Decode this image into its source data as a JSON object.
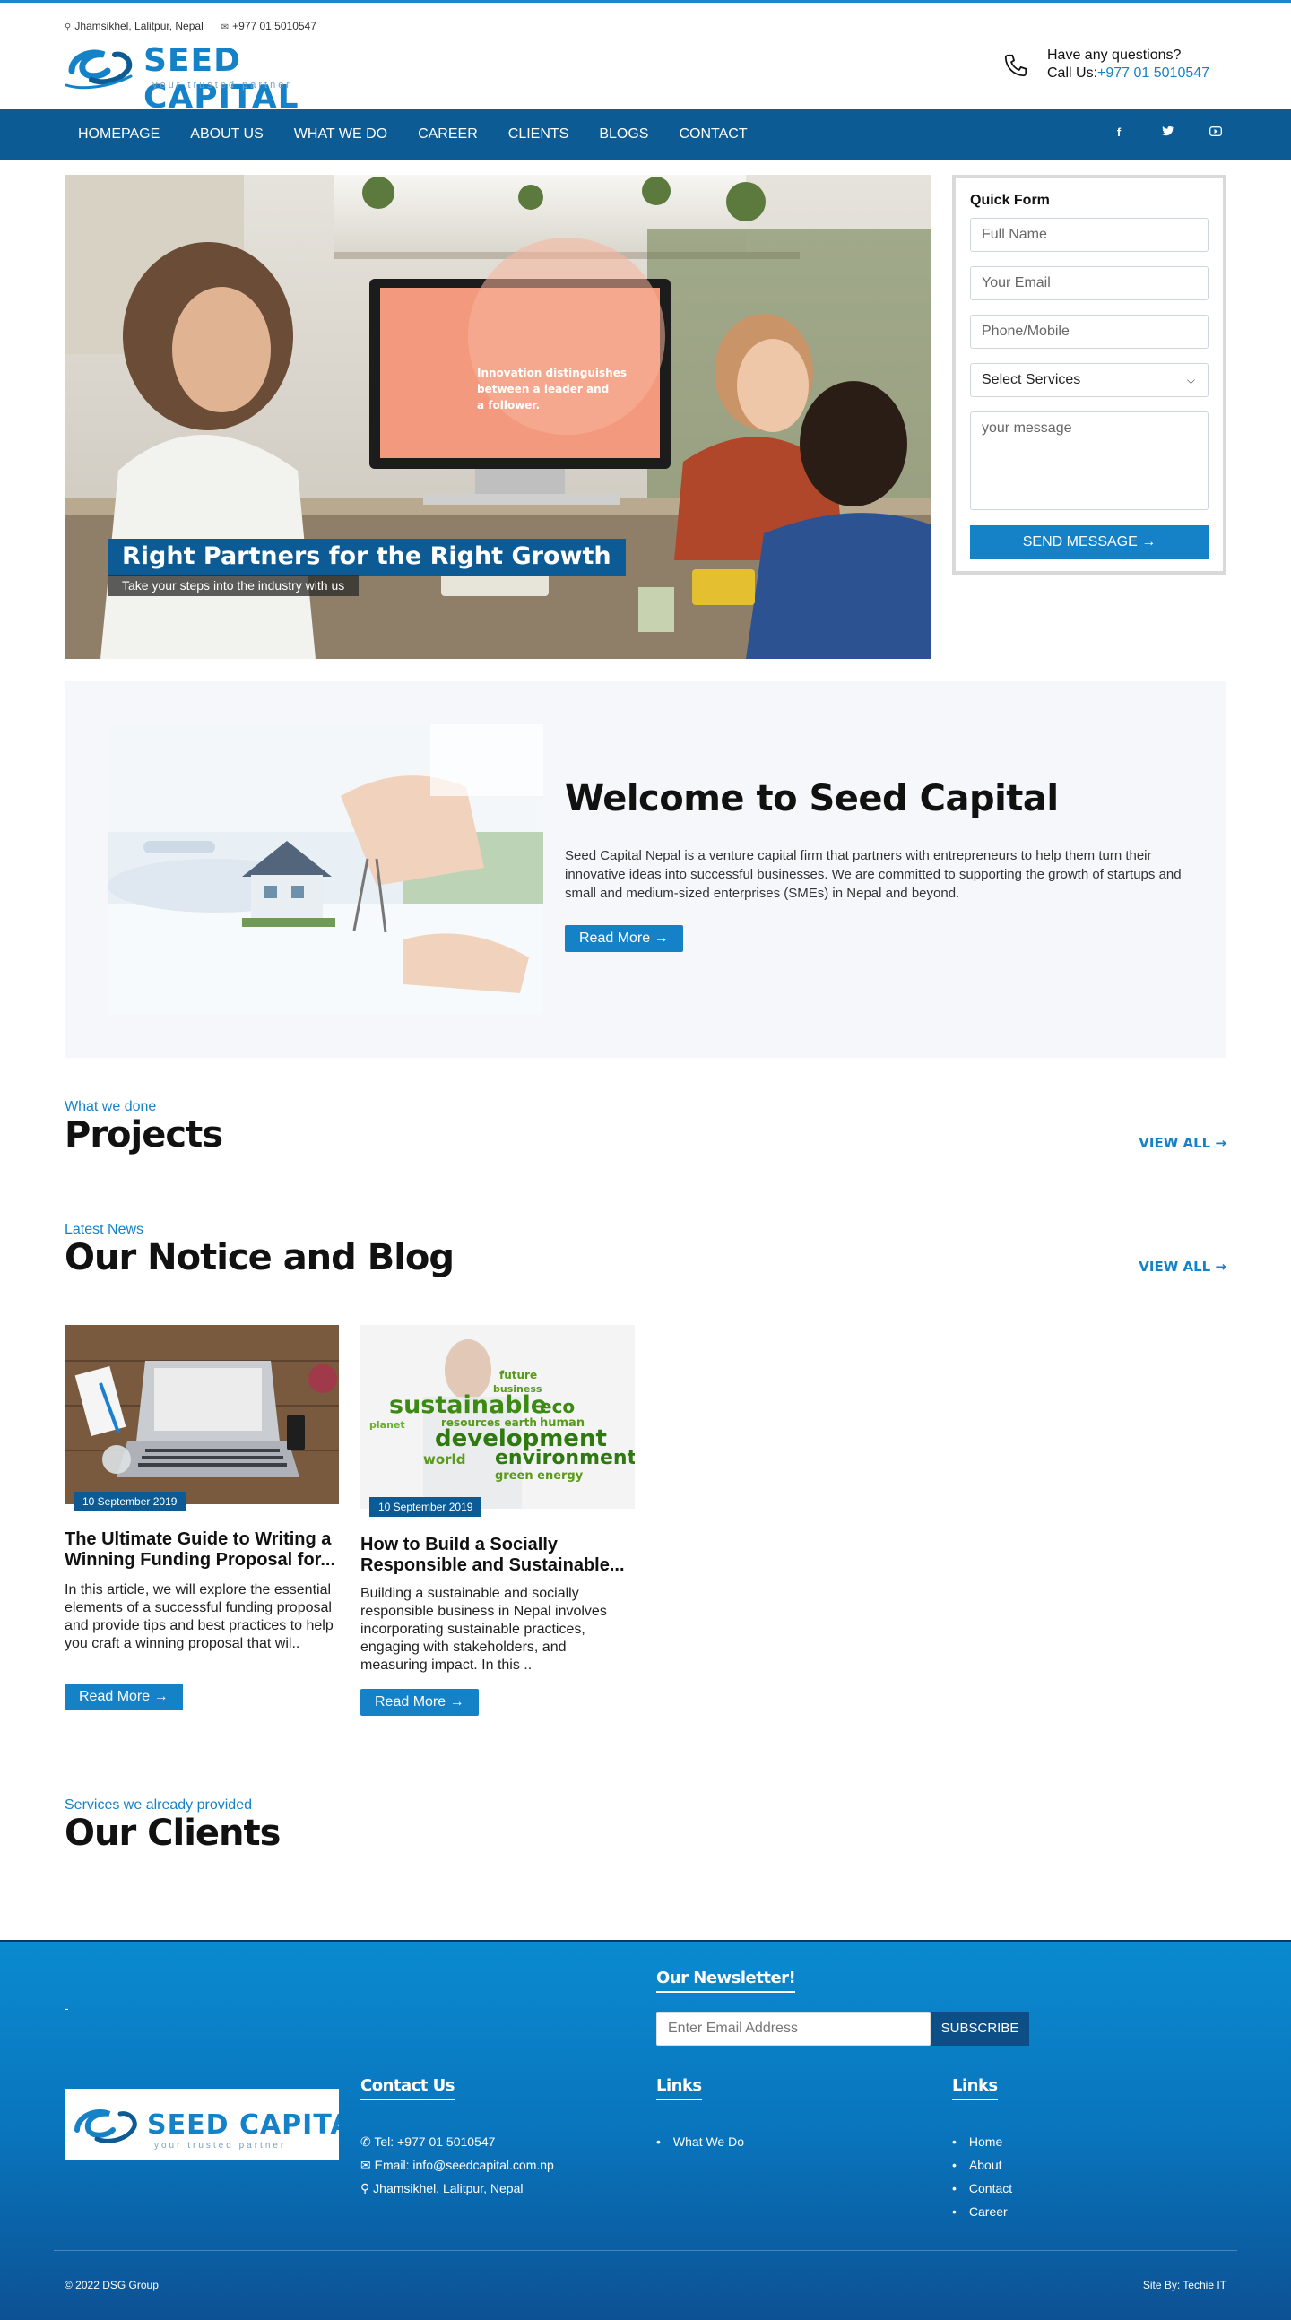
{
  "topbar": {
    "address": "Jhamsikhel, Lalitpur, Nepal",
    "phone": "+977 01 5010547"
  },
  "logo": {
    "name": "SEED CAPITAL",
    "tagline": "your trusted partner"
  },
  "contact_box": {
    "question": "Have any questions?",
    "call_label": "Call Us:",
    "call_number": "+977 01 5010547"
  },
  "nav": {
    "items": [
      "HOMEPAGE",
      "ABOUT US",
      "WHAT WE DO",
      "CAREER",
      "CLIENTS",
      "BLOGS",
      "CONTACT"
    ],
    "social": [
      "facebook-icon",
      "twitter-icon",
      "youtube-icon"
    ]
  },
  "hero": {
    "title": "Right Partners for the Right Growth",
    "subtitle": "Take your steps into the industry with us",
    "screen_text": "Innovation distinguishes between a leader and a follower."
  },
  "quick_form": {
    "title": "Quick Form",
    "full_name_placeholder": "Full Name",
    "email_placeholder": "Your Email",
    "phone_placeholder": "Phone/Mobile",
    "services_selected": "Select Services",
    "message_placeholder": "your message",
    "submit_label": "SEND MESSAGE →"
  },
  "welcome": {
    "title": "Welcome to Seed Capital",
    "text": "Seed Capital Nepal is a venture capital firm that partners with entrepreneurs to help them turn their innovative ideas into successful businesses. We are committed to supporting the growth of startups and small and medium-sized enterprises (SMEs) in Nepal and beyond.",
    "button": "Read More →"
  },
  "projects": {
    "eyebrow": "What we done",
    "title": "Projects",
    "view_all": "VIEW ALL →"
  },
  "blog": {
    "eyebrow": "Latest News",
    "title": "Our Notice and Blog",
    "view_all": "VIEW ALL →",
    "posts": [
      {
        "date": "10 September 2019",
        "title": "The Ultimate Guide to Writing a Winning Funding Proposal for...",
        "excerpt": "In this article, we will explore the essential elements of a successful funding proposal and provide tips and best practices to help you craft a winning proposal that wil..",
        "button": "Read More →"
      },
      {
        "date": "10 September 2019",
        "title": "How to Build a Socially Responsible and Sustainable...",
        "excerpt": "Building a sustainable and socially responsible business in Nepal involves incorporating sustainable practices, engaging with stakeholders, and measuring impact. In this ..",
        "button": "Read More →"
      }
    ]
  },
  "clients": {
    "eyebrow": "Services we already provided",
    "title": "Our Clients"
  },
  "footer": {
    "dash": "-",
    "newsletter_title": "Our Newsletter!",
    "newsletter_placeholder": "Enter Email Address",
    "subscribe": "SUBSCRIBE",
    "contact_title": "Contact Us",
    "contact_items": [
      "Tel: +977 01 5010547",
      "Email: info@seedcapital.com.np",
      "Jhamsikhel, Lalitpur, Nepal"
    ],
    "links1_title": "Links",
    "links1": [
      "What We Do"
    ],
    "links2_title": "Links",
    "links2": [
      "Home",
      "About",
      "Contact",
      "Career"
    ],
    "copyright": "© 2022 DSG Group",
    "site_by": "Site By: Techie IT"
  },
  "colors": {
    "primary": "#1582c8",
    "nav": "#0c5b94",
    "footer_top": "#0a8ad0",
    "footer_bottom": "#0c5193"
  }
}
